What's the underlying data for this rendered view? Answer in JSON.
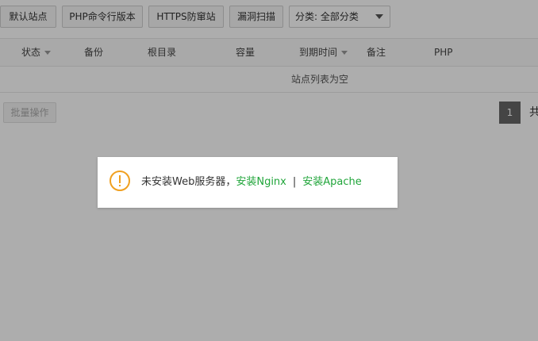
{
  "toolbar": {
    "default_site_label": "默认站点",
    "php_cli_label": "PHP命令行版本",
    "https_label": "HTTPS防窜站",
    "scan_label": "漏洞扫描",
    "category_select": {
      "selected": "分类: 全部分类"
    }
  },
  "table": {
    "columns": [
      "状态",
      "备份",
      "根目录",
      "容量",
      "到期时间",
      "备注",
      "PHP"
    ],
    "empty_text": "站点列表为空"
  },
  "footer": {
    "batch_label": "批量操作",
    "current_page": "1",
    "total_prefix": "共"
  },
  "dialog": {
    "message": "未安装Web服务器，",
    "install_nginx": "安装Nginx",
    "separator": "|",
    "install_apache": "安装Apache"
  },
  "colors": {
    "link": "#20a53a",
    "warning": "#f0a020",
    "page_active": "#666666"
  },
  "icons": {
    "warning": "warning-icon",
    "dropdown": "chevron-down-icon",
    "sort": "sort-down-icon"
  }
}
